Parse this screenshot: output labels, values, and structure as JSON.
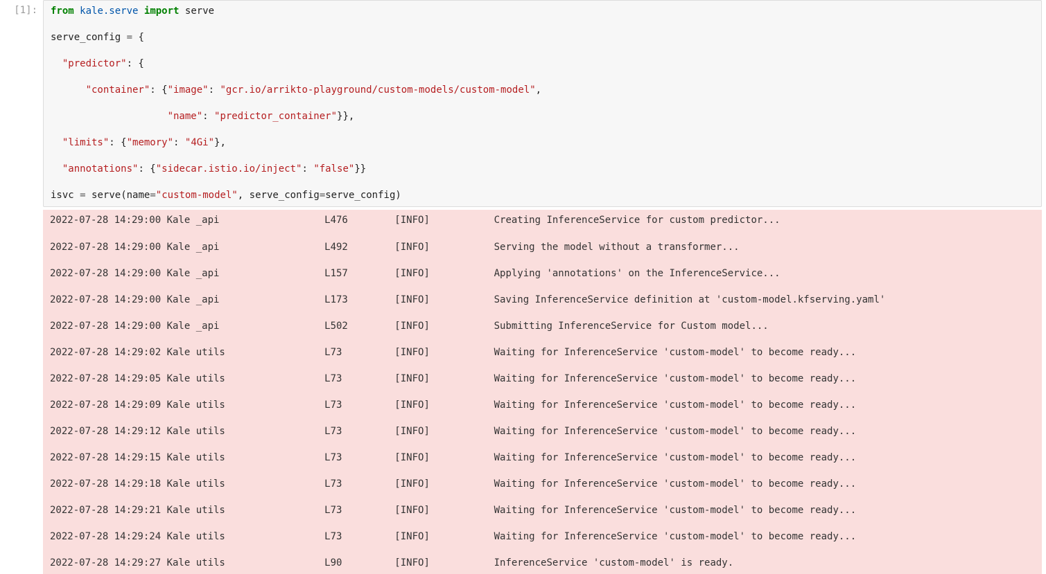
{
  "prompt": "[1]:",
  "code": {
    "tokens": [
      [
        {
          "t": "kw",
          "v": "from"
        },
        {
          "t": "sp",
          "v": " "
        },
        {
          "t": "mod",
          "v": "kale.serve"
        },
        {
          "t": "sp",
          "v": " "
        },
        {
          "t": "kw",
          "v": "import"
        },
        {
          "t": "sp",
          "v": " "
        },
        {
          "t": "name",
          "v": "serve"
        }
      ],
      [
        {
          "t": "name",
          "v": "serve_config"
        },
        {
          "t": "sp",
          "v": " "
        },
        {
          "t": "op",
          "v": "="
        },
        {
          "t": "sp",
          "v": " "
        },
        {
          "t": "punct",
          "v": "{"
        }
      ],
      [
        {
          "t": "sp",
          "v": "  "
        },
        {
          "t": "str",
          "v": "\"predictor\""
        },
        {
          "t": "punct",
          "v": ": {"
        }
      ],
      [
        {
          "t": "sp",
          "v": "      "
        },
        {
          "t": "str",
          "v": "\"container\""
        },
        {
          "t": "punct",
          "v": ": {"
        },
        {
          "t": "str",
          "v": "\"image\""
        },
        {
          "t": "punct",
          "v": ": "
        },
        {
          "t": "str",
          "v": "\"gcr.io/arrikto-playground/custom-models/custom-model\""
        },
        {
          "t": "punct",
          "v": ","
        }
      ],
      [
        {
          "t": "sp",
          "v": "                    "
        },
        {
          "t": "str",
          "v": "\"name\""
        },
        {
          "t": "punct",
          "v": ": "
        },
        {
          "t": "str",
          "v": "\"predictor_container\""
        },
        {
          "t": "punct",
          "v": "}},"
        }
      ],
      [
        {
          "t": "sp",
          "v": "  "
        },
        {
          "t": "str",
          "v": "\"limits\""
        },
        {
          "t": "punct",
          "v": ": {"
        },
        {
          "t": "str",
          "v": "\"memory\""
        },
        {
          "t": "punct",
          "v": ": "
        },
        {
          "t": "str",
          "v": "\"4Gi\""
        },
        {
          "t": "punct",
          "v": "},"
        }
      ],
      [
        {
          "t": "sp",
          "v": "  "
        },
        {
          "t": "str",
          "v": "\"annotations\""
        },
        {
          "t": "punct",
          "v": ": {"
        },
        {
          "t": "str",
          "v": "\"sidecar.istio.io/inject\""
        },
        {
          "t": "punct",
          "v": ": "
        },
        {
          "t": "str",
          "v": "\"false\""
        },
        {
          "t": "punct",
          "v": "}}"
        }
      ],
      [
        {
          "t": "name",
          "v": "isvc"
        },
        {
          "t": "sp",
          "v": " "
        },
        {
          "t": "op",
          "v": "="
        },
        {
          "t": "sp",
          "v": " "
        },
        {
          "t": "name",
          "v": "serve"
        },
        {
          "t": "punct",
          "v": "("
        },
        {
          "t": "name",
          "v": "name"
        },
        {
          "t": "op",
          "v": "="
        },
        {
          "t": "str",
          "v": "\"custom-model\""
        },
        {
          "t": "punct",
          "v": ", "
        },
        {
          "t": "name",
          "v": "serve_config"
        },
        {
          "t": "op",
          "v": "="
        },
        {
          "t": "name",
          "v": "serve_config"
        },
        {
          "t": "punct",
          "v": ")"
        }
      ]
    ]
  },
  "log": {
    "lines": [
      {
        "ts": "2022-07-28 14:29:00",
        "comp": "Kale _api ",
        "loc": "L476",
        "lvl": "[INFO]",
        "msg": "Creating InferenceService for custom predictor..."
      },
      {
        "ts": "2022-07-28 14:29:00",
        "comp": "Kale _api ",
        "loc": "L492",
        "lvl": "[INFO]",
        "msg": "Serving the model without a transformer..."
      },
      {
        "ts": "2022-07-28 14:29:00",
        "comp": "Kale _api ",
        "loc": "L157",
        "lvl": "[INFO]",
        "msg": "Applying 'annotations' on the InferenceService..."
      },
      {
        "ts": "2022-07-28 14:29:00",
        "comp": "Kale _api ",
        "loc": "L173",
        "lvl": "[INFO]",
        "msg": "Saving InferenceService definition at 'custom-model.kfserving.yaml'"
      },
      {
        "ts": "2022-07-28 14:29:00",
        "comp": "Kale _api ",
        "loc": "L502",
        "lvl": "[INFO]",
        "msg": "Submitting InferenceService for Custom model..."
      },
      {
        "ts": "2022-07-28 14:29:02",
        "comp": "Kale utils",
        "loc": "L73 ",
        "lvl": "[INFO]",
        "msg": "Waiting for InferenceService 'custom-model' to become ready..."
      },
      {
        "ts": "2022-07-28 14:29:05",
        "comp": "Kale utils",
        "loc": "L73 ",
        "lvl": "[INFO]",
        "msg": "Waiting for InferenceService 'custom-model' to become ready..."
      },
      {
        "ts": "2022-07-28 14:29:09",
        "comp": "Kale utils",
        "loc": "L73 ",
        "lvl": "[INFO]",
        "msg": "Waiting for InferenceService 'custom-model' to become ready..."
      },
      {
        "ts": "2022-07-28 14:29:12",
        "comp": "Kale utils",
        "loc": "L73 ",
        "lvl": "[INFO]",
        "msg": "Waiting for InferenceService 'custom-model' to become ready..."
      },
      {
        "ts": "2022-07-28 14:29:15",
        "comp": "Kale utils",
        "loc": "L73 ",
        "lvl": "[INFO]",
        "msg": "Waiting for InferenceService 'custom-model' to become ready..."
      },
      {
        "ts": "2022-07-28 14:29:18",
        "comp": "Kale utils",
        "loc": "L73 ",
        "lvl": "[INFO]",
        "msg": "Waiting for InferenceService 'custom-model' to become ready..."
      },
      {
        "ts": "2022-07-28 14:29:21",
        "comp": "Kale utils",
        "loc": "L73 ",
        "lvl": "[INFO]",
        "msg": "Waiting for InferenceService 'custom-model' to become ready..."
      },
      {
        "ts": "2022-07-28 14:29:24",
        "comp": "Kale utils",
        "loc": "L73 ",
        "lvl": "[INFO]",
        "msg": "Waiting for InferenceService 'custom-model' to become ready..."
      },
      {
        "ts": "2022-07-28 14:29:27",
        "comp": "Kale utils",
        "loc": "L90 ",
        "lvl": "[INFO]",
        "msg": "InferenceService 'custom-model' is ready."
      }
    ]
  }
}
